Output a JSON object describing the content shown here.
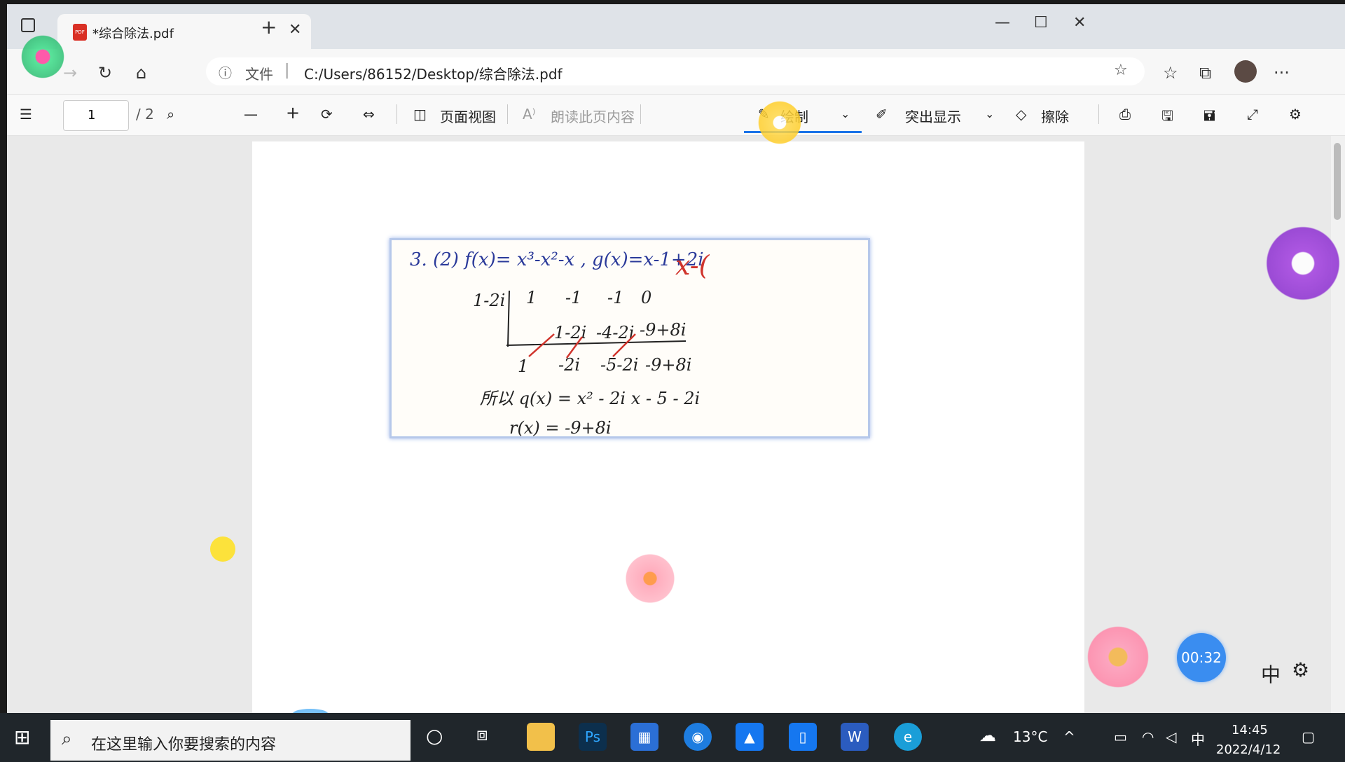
{
  "tab": {
    "title": "*综合除法.pdf",
    "close": "✕",
    "new": "+"
  },
  "window": {
    "minimize": "—",
    "maximize": "☐",
    "close": "✕"
  },
  "address": {
    "info_label": "文件",
    "url": "C:/Users/86152/Desktop/综合除法.pdf"
  },
  "pdf_toolbar": {
    "page_current": "1",
    "page_total": "/ 2",
    "page_view": "页面视图",
    "read_aloud": "朗读此页内容",
    "draw": "绘制",
    "highlight": "突出显示",
    "erase": "擦除"
  },
  "math": {
    "line1": "3. (2)  f(x)= x³-x²-x  , g(x)=x-1+2i",
    "red_note": "x-(",
    "divisor": "1-2i",
    "coef_row": [
      "1",
      "-1",
      "-1",
      "0"
    ],
    "mid_row": [
      "1-2i",
      "-4-2i",
      "-9+8i"
    ],
    "result_row": [
      "1",
      "-2i",
      "-5-2i",
      "-9+8i"
    ],
    "quotient": "所以 q(x) = x² - 2i x - 5 - 2i",
    "remainder": "r(x) = -9+8i"
  },
  "timer": "00:32",
  "ime": {
    "lang": "中"
  },
  "taskbar": {
    "search_placeholder": "在这里输入你要搜索的内容",
    "weather": "13°C",
    "ime": "中",
    "time": "14:45",
    "date": "2022/4/12"
  },
  "colors": {
    "accent": "#1a73e8",
    "pen_blue": "#2b3a9a",
    "pen_red": "#d0342c",
    "taskbar": "#20262b"
  }
}
